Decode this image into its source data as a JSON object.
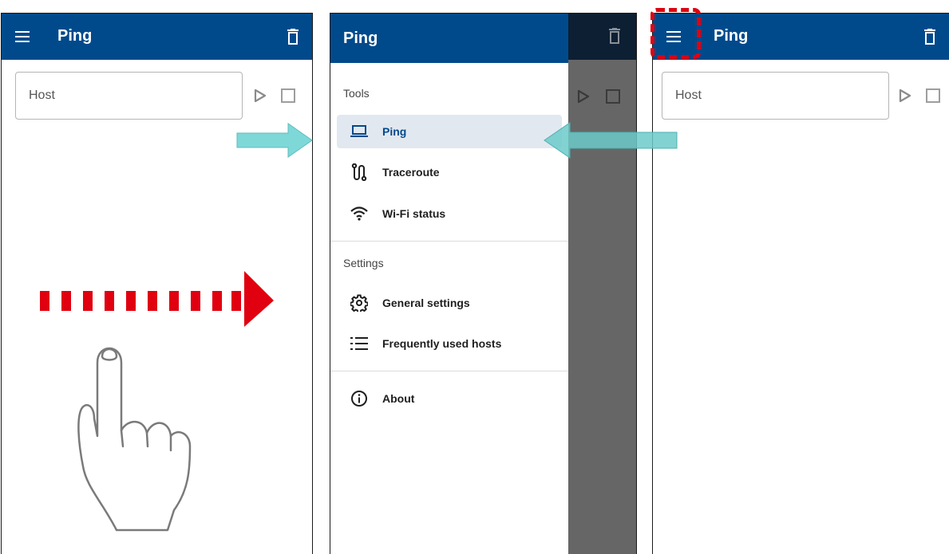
{
  "left_screen": {
    "title": "Ping",
    "host_placeholder": "Host"
  },
  "middle_screen": {
    "drawer_title": "Ping",
    "tools_label": "Tools",
    "settings_label": "Settings",
    "tools_items": [
      {
        "label": "Ping",
        "icon": "laptop-icon",
        "active": true
      },
      {
        "label": "Traceroute",
        "icon": "route-icon"
      },
      {
        "label": "Wi-Fi status",
        "icon": "wifi-icon"
      }
    ],
    "settings_items": [
      {
        "label": "General settings",
        "icon": "gear-icon"
      },
      {
        "label": "Frequently used hosts",
        "icon": "list-icon"
      }
    ],
    "other_items": [
      {
        "label": "About",
        "icon": "info-icon"
      }
    ]
  },
  "right_screen": {
    "title": "Ping",
    "host_placeholder": "Host"
  },
  "colors": {
    "app_bar": "#004a8c",
    "swipe_arrow": "#e0000f",
    "callout_arrow": "#7fd8d8",
    "highlight_box": "#e0000f"
  }
}
